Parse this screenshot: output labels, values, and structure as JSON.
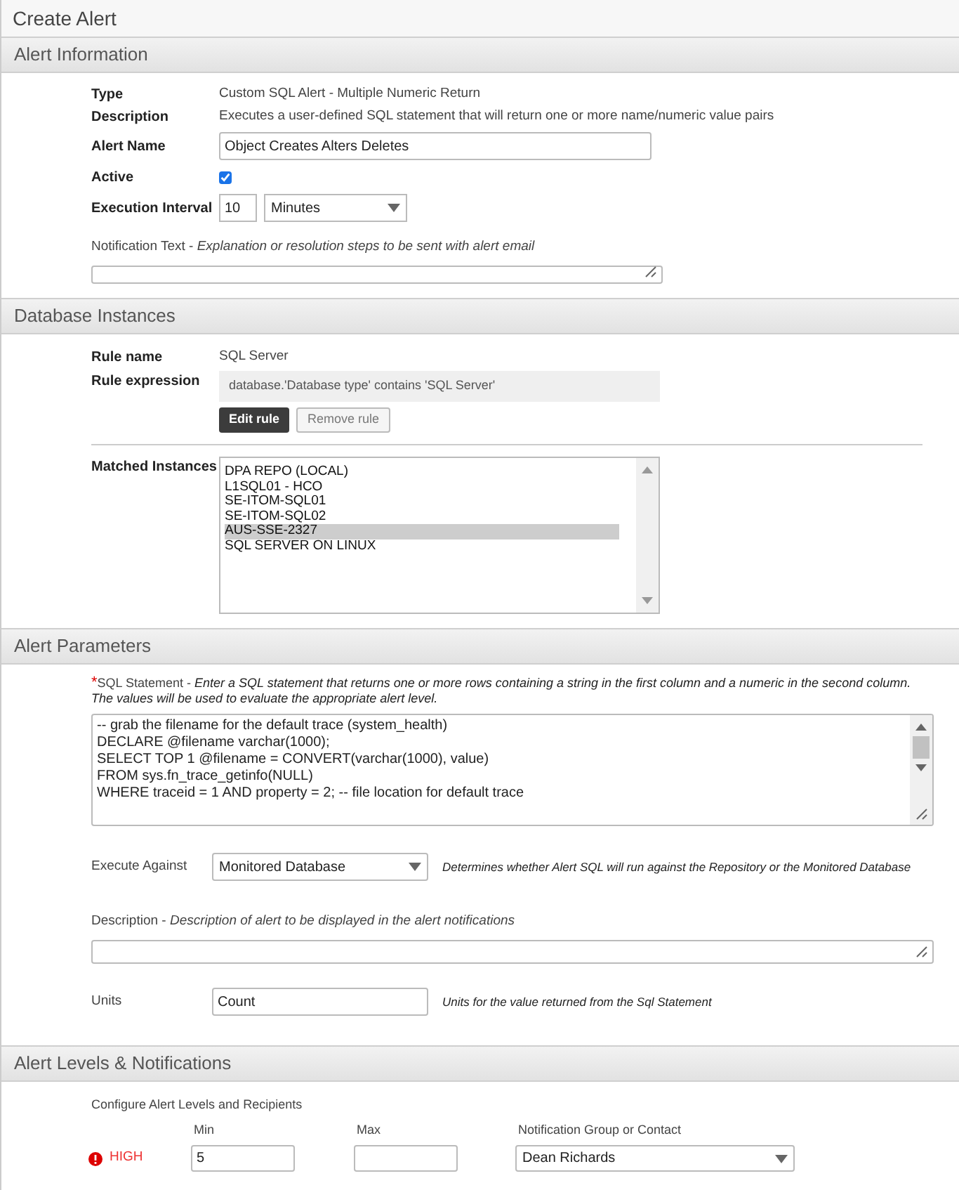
{
  "page_title": "Create Alert",
  "alert_information": {
    "title": "Alert Information",
    "type": {
      "label": "Type",
      "value": "Custom SQL Alert - Multiple Numeric Return"
    },
    "description": {
      "label": "Description",
      "value": "Executes a user-defined SQL statement that will return one or more name/numeric value pairs"
    },
    "alert_name": {
      "label": "Alert Name",
      "value": "Object Creates Alters Deletes"
    },
    "active": {
      "label": "Active",
      "checked": true
    },
    "execution_interval": {
      "label": "Execution Interval",
      "value": "10",
      "unit": "Minutes"
    },
    "notification_text": {
      "label": "Notification Text -",
      "hint": "Explanation or resolution steps to be sent with alert email"
    }
  },
  "database_instances": {
    "title": "Database Instances",
    "rule_name": {
      "label": "Rule name",
      "value": "SQL Server"
    },
    "rule_expression": {
      "label": "Rule expression",
      "value": "database.'Database type' contains 'SQL Server'"
    },
    "buttons": [
      "Edit rule",
      "Remove rule"
    ],
    "matched_label": "Matched Instances",
    "instances": [
      {
        "name": "DPA REPO (LOCAL)",
        "selected": false
      },
      {
        "name": "L1SQL01 - HCO",
        "selected": false
      },
      {
        "name": "SE-ITOM-SQL01",
        "selected": false
      },
      {
        "name": "SE-ITOM-SQL02",
        "selected": false
      },
      {
        "name": "AUS-SSE-2327",
        "selected": true
      },
      {
        "name": "SQL SERVER ON LINUX",
        "selected": false
      }
    ]
  },
  "alert_parameters": {
    "title": "Alert Parameters",
    "sql_statement": {
      "required_mark": "*",
      "label": "SQL Statement -",
      "hint": "Enter a SQL statement that returns one or more rows containing a string in the first column and a numeric in the second column. The values will be used to evaluate the appropriate alert level.",
      "lines": [
        "-- grab the filename for the default trace (system_health)",
        "DECLARE @filename varchar(1000);",
        "SELECT TOP 1 @filename = CONVERT(varchar(1000), value)",
        "FROM sys.fn_trace_getinfo(NULL)",
        "WHERE traceid = 1 AND property = 2; -- file location for default trace"
      ]
    },
    "execute_against": {
      "label": "Execute Against",
      "value": "Monitored Database",
      "hint": "Determines whether Alert SQL will run against the Repository or the Monitored Database"
    },
    "description": {
      "label": "Description -",
      "hint": "Description of alert to be displayed in the alert notifications"
    },
    "units": {
      "label": "Units",
      "value": "Count",
      "hint": "Units for the value returned from the Sql Statement"
    }
  },
  "alert_levels": {
    "title": "Alert Levels & Notifications",
    "subtitle": "Configure Alert Levels and Recipients",
    "columns": [
      "Min",
      "Max",
      "Notification Group or Contact"
    ],
    "levels": [
      {
        "name": "HIGH",
        "min": "5",
        "contact": "Dean Richards"
      }
    ]
  }
}
